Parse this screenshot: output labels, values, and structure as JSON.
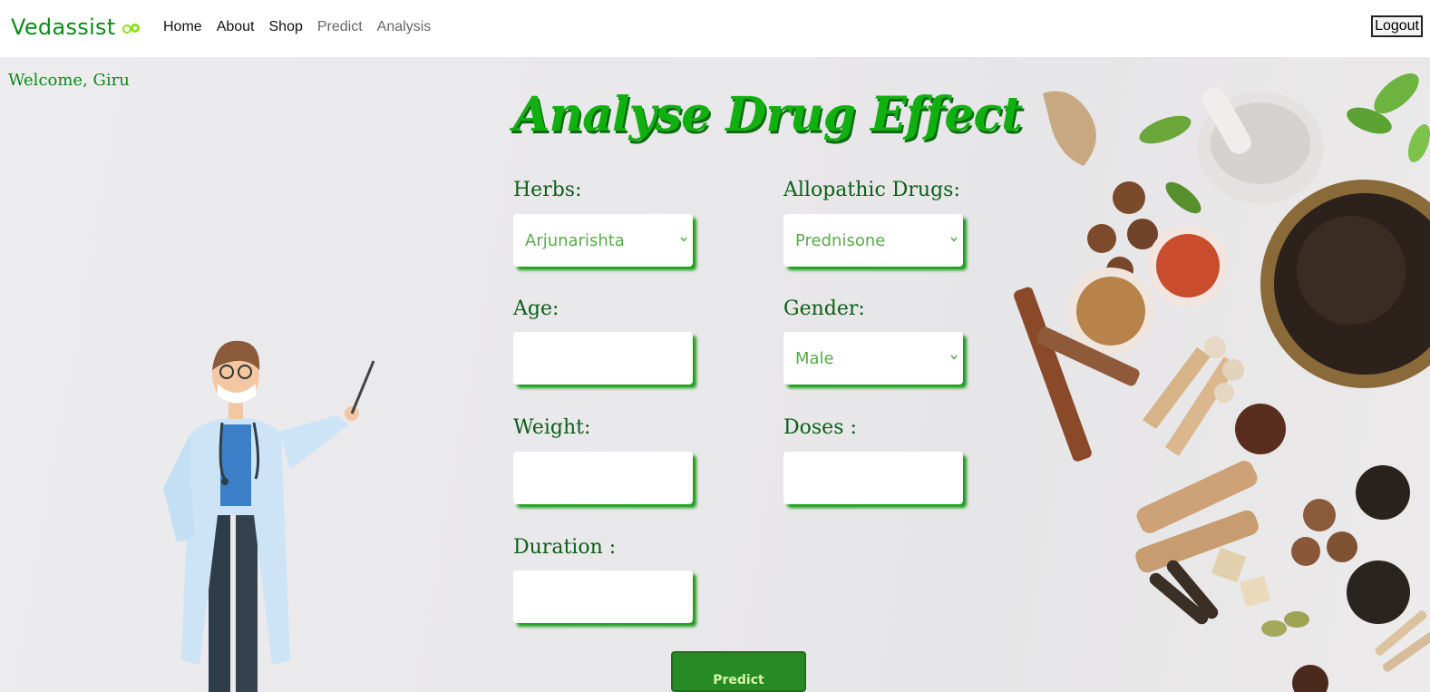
{
  "nav": {
    "brand": "Vedassist",
    "links": [
      {
        "label": "Home"
      },
      {
        "label": "About"
      },
      {
        "label": "Shop"
      },
      {
        "label": "Predict"
      },
      {
        "label": "Analysis"
      }
    ],
    "logout_label": "Logout"
  },
  "welcome": "Welcome, Giru",
  "title": "Analyse Drug Effect",
  "form": {
    "herbs": {
      "label": "Herbs:",
      "value": "Arjunarishta"
    },
    "drugs": {
      "label": "Allopathic Drugs:",
      "value": "Prednisone"
    },
    "age": {
      "label": "Age:",
      "value": ""
    },
    "gender": {
      "label": "Gender:",
      "value": "Male"
    },
    "weight": {
      "label": "Weight:",
      "value": ""
    },
    "doses": {
      "label": "Doses :",
      "value": ""
    },
    "duration": {
      "label": "Duration :",
      "value": ""
    },
    "predict_label": "Predict"
  },
  "colors": {
    "accent": "#0c8a1a",
    "title": "#11b011",
    "button": "#268a25",
    "field_shadow": "#1a9d19"
  }
}
